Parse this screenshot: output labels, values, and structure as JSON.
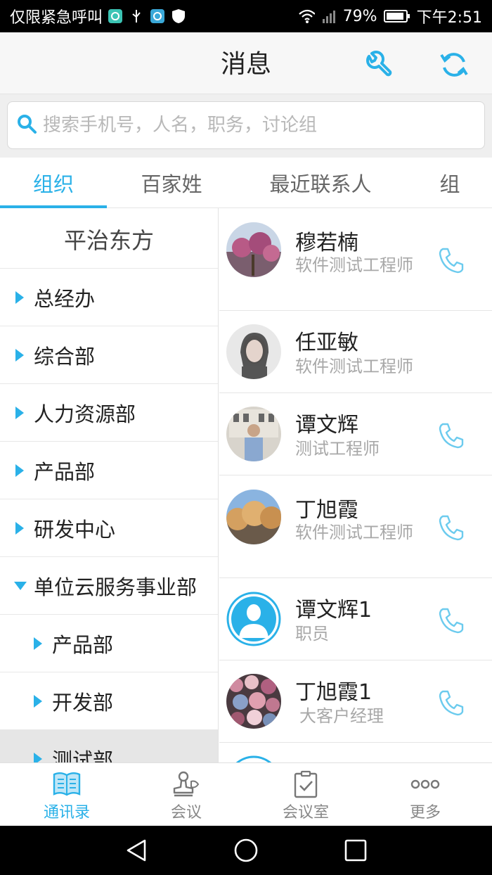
{
  "status": {
    "left_text": "仅限紧急呼叫",
    "battery": "79%",
    "time": "下午2:51"
  },
  "header": {
    "title": "消息"
  },
  "search": {
    "placeholder": "搜索手机号，人名，职务，讨论组"
  },
  "tabs": [
    {
      "label": "组织",
      "active": true
    },
    {
      "label": "百家姓",
      "active": false
    },
    {
      "label": "最近联系人",
      "active": false
    },
    {
      "label": "组",
      "active": false
    }
  ],
  "org": {
    "name": "平治东方",
    "departments": [
      {
        "label": "总经办",
        "expanded": false,
        "level": 0
      },
      {
        "label": "综合部",
        "expanded": false,
        "level": 0
      },
      {
        "label": "人力资源部",
        "expanded": false,
        "level": 0
      },
      {
        "label": "产品部",
        "expanded": false,
        "level": 0
      },
      {
        "label": "研发中心",
        "expanded": false,
        "level": 0
      },
      {
        "label": "单位云服务事业部",
        "expanded": true,
        "level": 0
      },
      {
        "label": "产品部",
        "expanded": false,
        "level": 1
      },
      {
        "label": "开发部",
        "expanded": false,
        "level": 1
      },
      {
        "label": "测试部",
        "expanded": false,
        "level": 1,
        "selected": true
      }
    ]
  },
  "contacts": [
    {
      "name": "穆若楠",
      "title": "软件测试工程师",
      "avatar": "photo-flowers-tree",
      "has_phone": true
    },
    {
      "name": "任亚敏",
      "title": "软件测试工程师",
      "avatar": "photo-woman",
      "has_phone": false
    },
    {
      "name": "谭文辉",
      "title": "测试工程师",
      "avatar": "photo-man",
      "has_phone": true
    },
    {
      "name": "丁旭霞",
      "title": "软件测试工程师",
      "avatar": "photo-autumn-trees",
      "has_phone": true
    },
    {
      "name": "谭文辉1",
      "title": "职员",
      "avatar": "default-person",
      "has_phone": true
    },
    {
      "name": "丁旭霞1",
      "title": "大客户经理",
      "avatar": "photo-flowers",
      "has_phone": true
    }
  ],
  "bottom_nav": [
    {
      "label": "通讯录",
      "icon": "contacts-book-icon",
      "active": true
    },
    {
      "label": "会议",
      "icon": "meeting-stamp-icon",
      "active": false
    },
    {
      "label": "会议室",
      "icon": "meeting-room-clipboard-icon",
      "active": false
    },
    {
      "label": "更多",
      "icon": "more-dots-icon",
      "active": false
    }
  ],
  "colors": {
    "accent": "#2ab1e8",
    "status_bar": "#000000",
    "header_bg": "#f7f7f7"
  }
}
